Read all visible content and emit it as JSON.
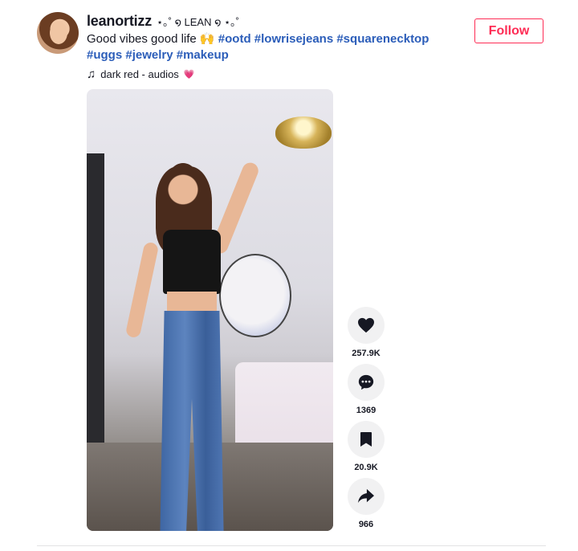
{
  "author": {
    "username": "leanortizz",
    "nickname": "⋆｡˚ ໑ LEAN ໑ ⋆｡˚"
  },
  "caption": {
    "text": "Good vibes good life 🙌",
    "hashtags": [
      "#ootd",
      "#lowrisejeans",
      "#squarenecktop",
      "#uggs",
      "#jewelry",
      "#makeup"
    ]
  },
  "music": {
    "note_icon": "♫",
    "title": "dark red - audios",
    "emoji": "💗"
  },
  "follow": {
    "label": "Follow",
    "color": "#fe2c55"
  },
  "actions": {
    "likes": {
      "icon": "heart-icon",
      "count": "257.9K"
    },
    "comments": {
      "icon": "comment-icon",
      "count": "1369"
    },
    "saves": {
      "icon": "bookmark-icon",
      "count": "20.9K"
    },
    "shares": {
      "icon": "share-icon",
      "count": "966"
    }
  },
  "colors": {
    "hashtag": "#2b5db9",
    "text": "#161823",
    "action_bg": "#f1f1f2"
  }
}
